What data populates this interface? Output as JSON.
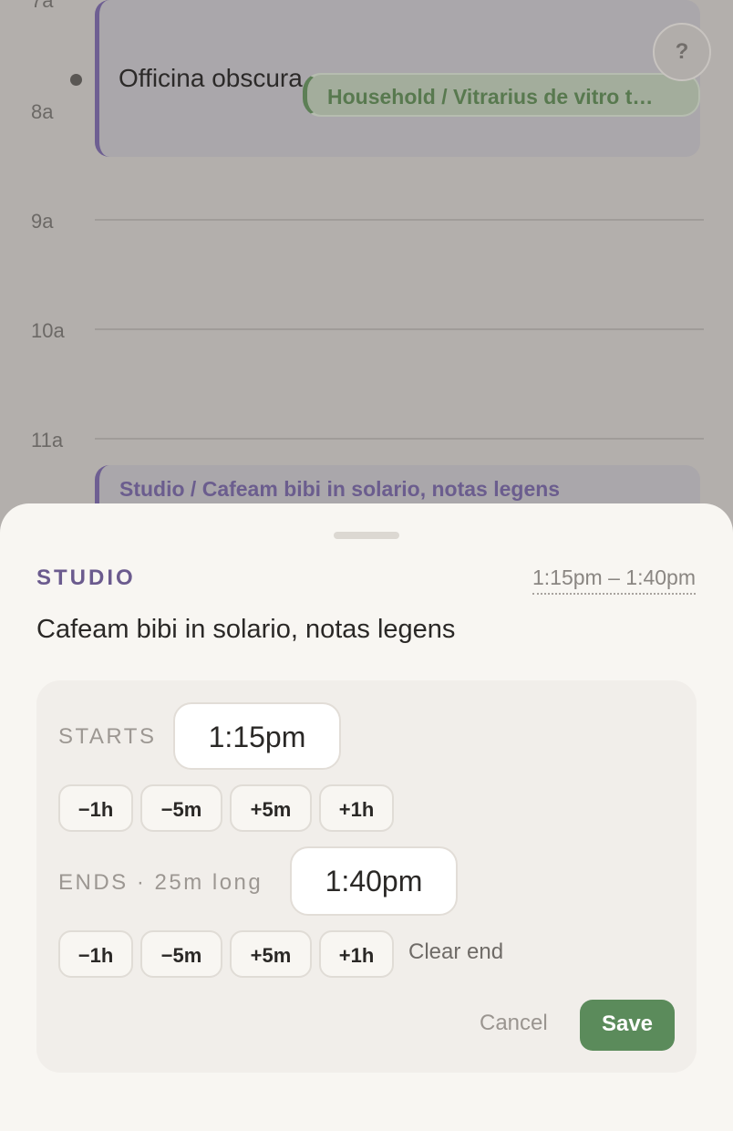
{
  "timeline": {
    "hours": [
      "7a",
      "8a",
      "9a",
      "10a",
      "11a"
    ],
    "events": {
      "office_title": "Officina obscura tabula constat",
      "household_chip": "Household / Vitrarius de vitro t…",
      "studio_chip": "Studio / Cafeam bibi in solario, notas legens"
    },
    "help_label": "?"
  },
  "sheet": {
    "category": "STUDIO",
    "time_range": "1:15pm – 1:40pm",
    "title": "Cafeam bibi in solario, notas legens",
    "starts": {
      "label": "STARTS",
      "value": "1:15pm",
      "adjust": [
        "−1h",
        "−5m",
        "+5m",
        "+1h"
      ]
    },
    "ends": {
      "label": "ENDS · 25m long",
      "value": "1:40pm",
      "adjust": [
        "−1h",
        "−5m",
        "+5m",
        "+1h"
      ],
      "clear_label": "Clear end"
    },
    "cancel_label": "Cancel",
    "save_label": "Save"
  },
  "colors": {
    "accent_studio": "#6b5b8e",
    "accent_household": "#5d7f56",
    "save_button": "#5b8b5b"
  }
}
